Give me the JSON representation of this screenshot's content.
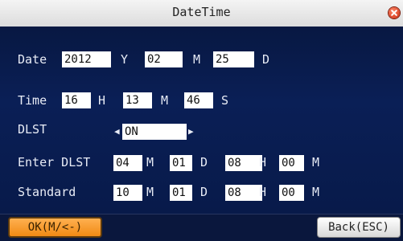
{
  "window": {
    "title": "DateTime"
  },
  "date": {
    "label": "Date",
    "year": "2012",
    "year_unit": "Y",
    "month": "02",
    "month_unit": "M",
    "day": "25",
    "day_unit": "D"
  },
  "time": {
    "label": "Time",
    "hour": "16",
    "hour_unit": "H",
    "minute": "13",
    "minute_unit": "M",
    "second": "46",
    "second_unit": "S"
  },
  "dlst": {
    "label": "DLST",
    "value": "ON",
    "left_arrow": "◀",
    "right_arrow": "▶"
  },
  "enter_dlst": {
    "label": "Enter DLST",
    "month": "04",
    "month_unit": "M",
    "day": "01",
    "day_unit": "D",
    "hour": "08",
    "hour_unit": "H",
    "minute": "00",
    "minute_unit": "M"
  },
  "standard": {
    "label": "Standard",
    "month": "10",
    "month_unit": "M",
    "day": "01",
    "day_unit": "D",
    "hour": "08",
    "hour_unit": "H",
    "minute": "00",
    "minute_unit": "M"
  },
  "buttons": {
    "ok_label": "OK(M/<-)",
    "back_label": "Back(ESC)"
  },
  "colors": {
    "background": "#081a4a",
    "ok_button": "#f08a14",
    "close_icon": "#c8240a"
  }
}
